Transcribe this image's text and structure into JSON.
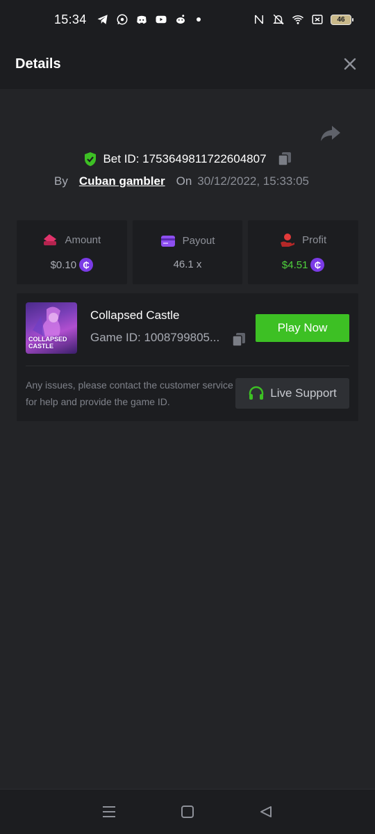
{
  "status_bar": {
    "time": "15:34",
    "battery_level": "46",
    "left_icons": [
      "telegram-icon",
      "whatsapp-icon",
      "discord-icon",
      "youtube-icon",
      "reddit-icon",
      "dot-icon"
    ],
    "right_icons": [
      "nfc-icon",
      "mute-icon",
      "wifi-icon",
      "close-box-icon",
      "battery-icon"
    ]
  },
  "header": {
    "title": "Details",
    "close_icon": "close-icon"
  },
  "bet": {
    "id_label": "Bet ID: 1753649811722604807",
    "by_label": "By",
    "user": "Cuban gambler",
    "on_label": "On",
    "date": "30/12/2022, 15:33:05"
  },
  "stats": [
    {
      "label": "Amount",
      "value": "$0.10",
      "icon": "amount-icon",
      "coin": "₵"
    },
    {
      "label": "Payout",
      "value": "46.1 x",
      "icon": "card-icon"
    },
    {
      "label": "Profit",
      "value": "$4.51",
      "icon": "profit-icon",
      "coin": "₵"
    }
  ],
  "game": {
    "title": "Collapsed Castle",
    "id_label": "Game ID: 1008799805...",
    "thumb_text": "COLLAPSED CASTLE",
    "play_label": "Play Now",
    "issue_text": "Any issues, please contact the customer service for help and provide the game ID.",
    "support_label": "Live Support"
  },
  "colors": {
    "accent_green": "#3dc024",
    "profit_green": "#4fd13c",
    "coin_purple": "#7b3be6",
    "bg": "#232427",
    "card": "#1c1d20"
  }
}
